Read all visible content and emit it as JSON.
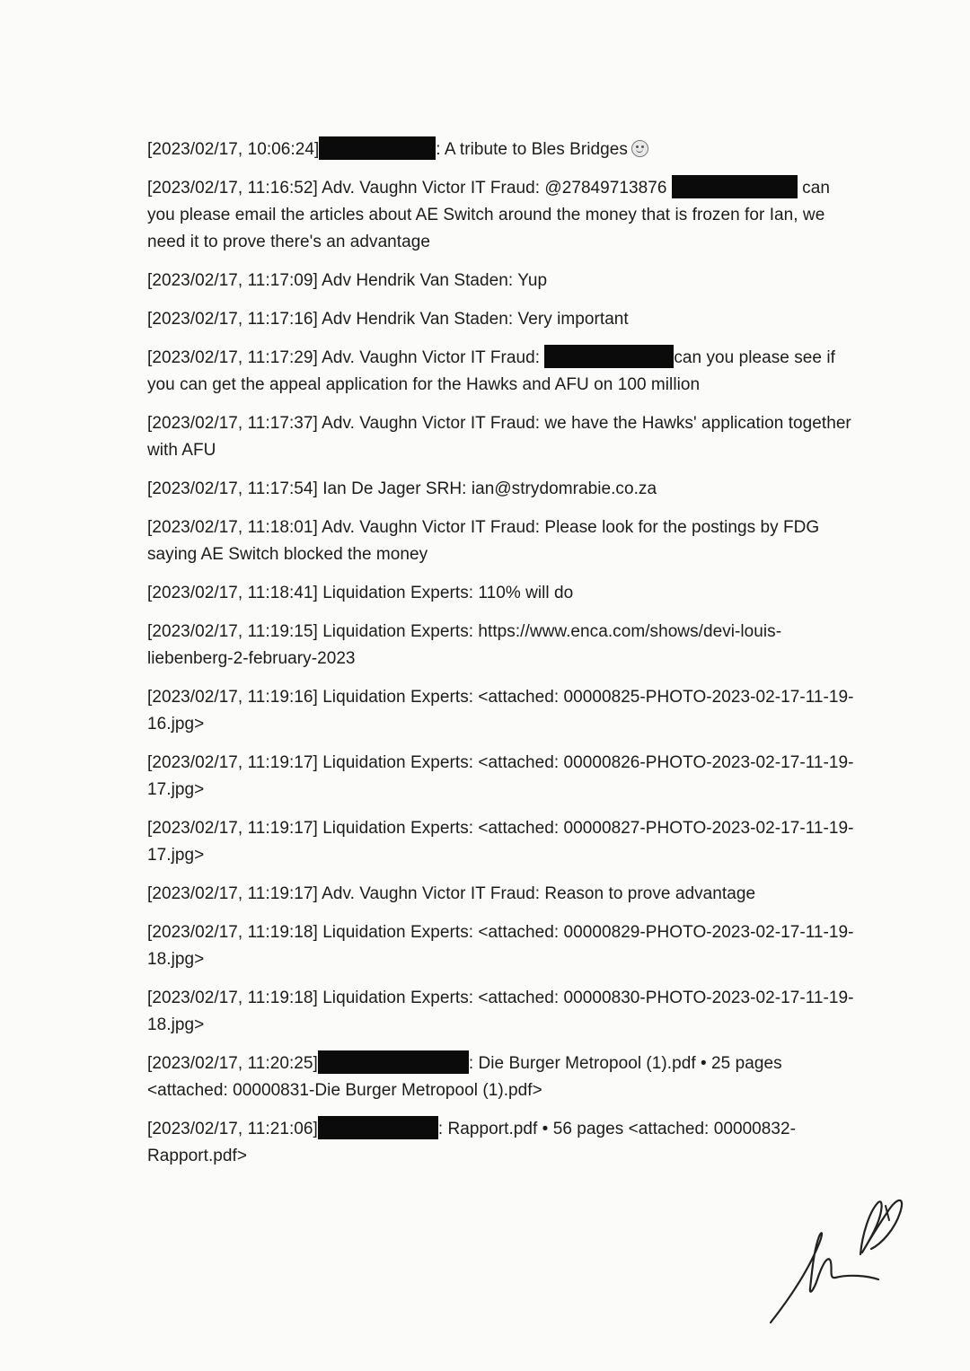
{
  "messages": [
    {
      "ts": "[2023/02/17, 10:06:24]",
      "pre": "",
      "redact_w": 130,
      "text": ": A tribute to Bles Bridges",
      "emoji": true
    },
    {
      "ts": "[2023/02/17, 11:16:52]",
      "pre": " Adv. Vaughn Victor IT Fraud: @27849713876",
      "redact_w": 140,
      "text": " can you please email the articles about AE Switch around the money that is frozen for Ian, we need it to prove there's an advantage"
    },
    {
      "ts": "[2023/02/17, 11:17:09]",
      "text": " Adv Hendrik Van Staden: Yup"
    },
    {
      "ts": "[2023/02/17, 11:17:16]",
      "text": " Adv Hendrik Van Staden: Very important"
    },
    {
      "ts": "[2023/02/17, 11:17:29]",
      "pre": " Adv. Vaughn Victor IT Fraud: ",
      "redact_w": 144,
      "text": "can you please see if you can get the appeal application for the Hawks and AFU on 100 million"
    },
    {
      "ts": "[2023/02/17, 11:17:37]",
      "text": " Adv. Vaughn Victor IT Fraud: we have the Hawks' application together with AFU"
    },
    {
      "ts": "[2023/02/17, 11:17:54]",
      "text": " Ian De Jager SRH: ian@strydomrabie.co.za"
    },
    {
      "ts": "[2023/02/17, 11:18:01]",
      "text": " Adv. Vaughn Victor IT Fraud: Please look for the postings by FDG saying AE Switch blocked the money"
    },
    {
      "ts": "[2023/02/17, 11:18:41]",
      "text": " Liquidation Experts: 110% will do"
    },
    {
      "ts": "[2023/02/17, 11:19:15]",
      "text": " Liquidation Experts: https://www.enca.com/shows/devi-louis-liebenberg-2-february-2023"
    },
    {
      "ts": "[2023/02/17, 11:19:16]",
      "text": " Liquidation Experts: <attached: 00000825-PHOTO-2023-02-17-11-19-16.jpg>"
    },
    {
      "ts": "[2023/02/17, 11:19:17]",
      "text": " Liquidation Experts: <attached: 00000826-PHOTO-2023-02-17-11-19-17.jpg>"
    },
    {
      "ts": "[2023/02/17, 11:19:17]",
      "text": " Liquidation Experts: <attached: 00000827-PHOTO-2023-02-17-11-19-17.jpg>"
    },
    {
      "ts": "[2023/02/17, 11:19:17]",
      "text": " Adv. Vaughn Victor IT Fraud: Reason to prove advantage"
    },
    {
      "ts": "[2023/02/17, 11:19:18]",
      "text": " Liquidation Experts: <attached: 00000829-PHOTO-2023-02-17-11-19-18.jpg>"
    },
    {
      "ts": "[2023/02/17, 11:19:18]",
      "text": " Liquidation Experts: <attached: 00000830-PHOTO-2023-02-17-11-19-18.jpg>"
    },
    {
      "ts": "[2023/02/17, 11:20:25]",
      "pre": "",
      "redact_w": 168,
      "text": ": Die Burger Metropool (1).pdf • 25 pages <attached: 00000831-Die Burger Metropool (1).pdf>"
    },
    {
      "ts": "[2023/02/17, 11:21:06]",
      "pre": "",
      "redact_w": 134,
      "text": ": Rapport.pdf • 56 pages <attached: 00000832-Rapport.pdf>"
    }
  ]
}
